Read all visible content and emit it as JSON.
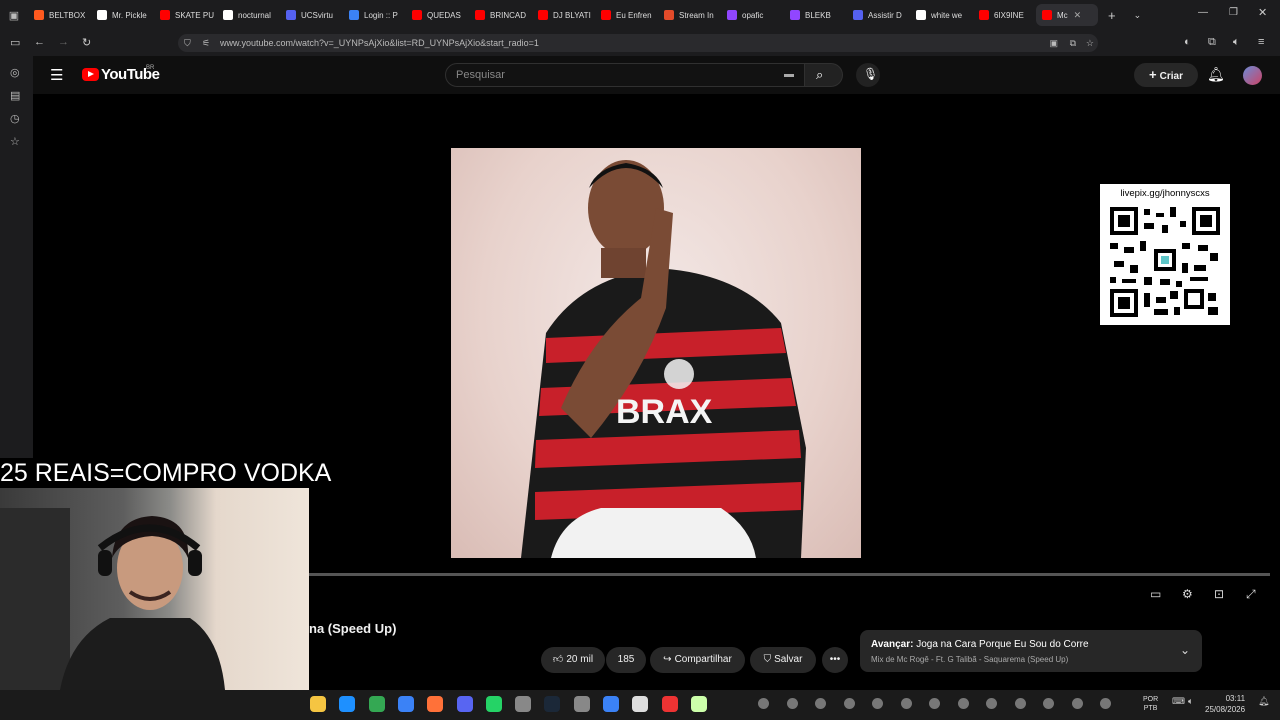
{
  "browser": {
    "tabs": [
      {
        "label": "BELTBOX",
        "color": "#ff5a1f"
      },
      {
        "label": "Mr. Pickle",
        "color": "#ffffff"
      },
      {
        "label": "SKATE PU",
        "color": "#ff0000"
      },
      {
        "label": "nocturnal",
        "color": "#ffffff"
      },
      {
        "label": "UCSvirtu",
        "color": "#5561f0"
      },
      {
        "label": "Login :: P",
        "color": "#3b82f6"
      },
      {
        "label": "QUEDAS",
        "color": "#ff0000"
      },
      {
        "label": "BRINCAD",
        "color": "#ff0000"
      },
      {
        "label": "DJ BLYATI",
        "color": "#ff0000"
      },
      {
        "label": "Eu Enfren",
        "color": "#ff0000"
      },
      {
        "label": "Stream In",
        "color": "#e34b2a"
      },
      {
        "label": "opafic",
        "color": "#9146ff"
      },
      {
        "label": "BLEKB",
        "color": "#9146ff"
      },
      {
        "label": "Assistir D",
        "color": "#5561f0"
      },
      {
        "label": "white we",
        "color": "#ffffff"
      },
      {
        "label": "6IX9INE",
        "color": "#ff0000"
      },
      {
        "label": "Mc",
        "color": "#ff0000",
        "active": true
      }
    ],
    "url": "www.youtube.com/watch?v=_UYNPsAjXio&list=RD_UYNPsAjXio&start_radio=1"
  },
  "youtube": {
    "logo_text": "YouTube",
    "region": "BR",
    "search_placeholder": "Pesquisar",
    "create_label": "Criar"
  },
  "overlay": {
    "donation_text": "25 REAIS=COMPRO VODKA",
    "qr_caption": "livepix.gg/jhonnyscxs"
  },
  "video": {
    "title_partial": "na (Speed Up)",
    "likes": "20 mil",
    "dislikes": "185",
    "share_label": "Compartilhar",
    "save_label": "Salvar",
    "progress_fraction": 0.0
  },
  "next_up": {
    "prefix": "Avançar:",
    "title": "Joga na Cara Porque Eu Sou do Corre",
    "subtitle": "Mix de Mc Rogê - Ft. G Talibã - Saquarema (Speed Up)"
  },
  "taskbar": {
    "lang_top": "POR",
    "lang_bottom": "PTB",
    "time": "03:11",
    "date": "25/08/2026"
  },
  "colors": {
    "youtube_red": "#ff0000",
    "background": "#000000",
    "pill_bg": "#272727"
  }
}
